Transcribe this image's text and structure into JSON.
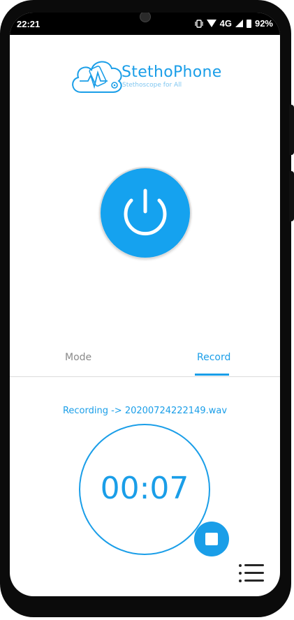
{
  "status_bar": {
    "time": "22:21",
    "network": "4G",
    "battery": "92%"
  },
  "logo": {
    "title": "StethoPhone",
    "subtitle": "Stethoscope for All"
  },
  "tabs": [
    {
      "label": "Mode",
      "active": false
    },
    {
      "label": "Record",
      "active": true
    }
  ],
  "recording": {
    "file_text": "Recording -> 20200724222149.wav",
    "elapsed": "00:07"
  },
  "colors": {
    "accent": "#1a9ee8",
    "power_button": "#15a2ef",
    "inactive_tab": "#8a8a8a"
  },
  "icons": {
    "power": "power-icon",
    "stop": "stop-icon",
    "menu": "list-menu-icon"
  }
}
